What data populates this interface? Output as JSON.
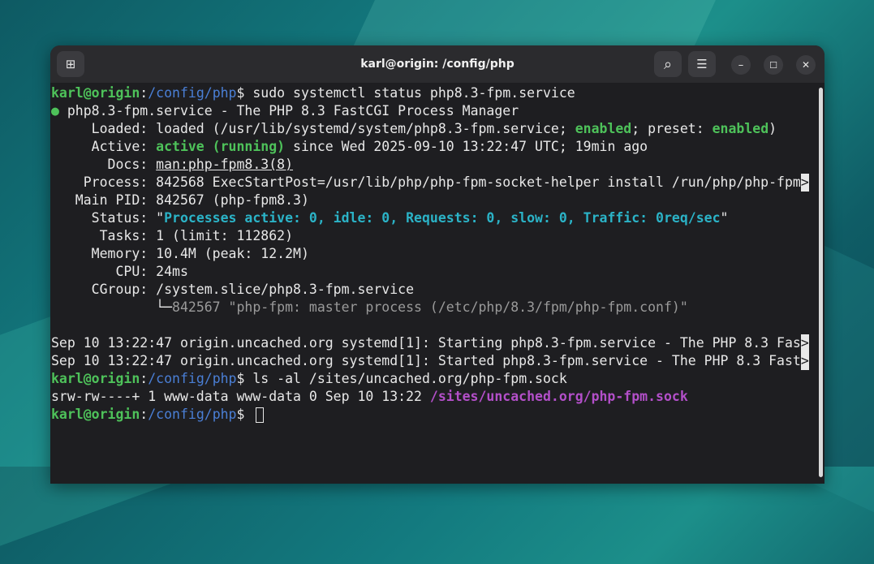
{
  "window": {
    "title": "karl@origin: /config/php"
  },
  "icons": {
    "new_tab": "⊞",
    "search": "⌕",
    "menu": "☰",
    "minimize": "–",
    "maximize": "☐",
    "close": "✕"
  },
  "terminal": {
    "prompt_user": "karl@origin",
    "prompt_sep": ":",
    "prompt_path": "/config/php",
    "prompt_end": "$ ",
    "cmd1": "sudo systemctl status php8.3-fpm.service",
    "status_dot": "●",
    "service_line": " php8.3-fpm.service - The PHP 8.3 FastCGI Process Manager",
    "loaded_pre": "     Loaded: loaded (/usr/lib/systemd/system/php8.3-fpm.service; ",
    "enabled1": "enabled",
    "loaded_mid": "; preset: ",
    "enabled2": "enabled",
    "loaded_post": ")",
    "active_pre": "     Active: ",
    "active_state": "active (running)",
    "active_post": " since Wed 2025-09-10 13:22:47 UTC; 19min ago",
    "docs_pre": "       Docs: ",
    "docs_link": "man:php-fpm8.3(8)",
    "process_line": "    Process: 842568 ExecStartPost=/usr/lib/php/php-fpm-socket-helper install /run/php/php-fpm",
    "mainpid_line": "   Main PID: 842567 (php-fpm8.3)",
    "status_pre": "     Status: \"",
    "status_val": "Processes active: 0, idle: 0, Requests: 0, slow: 0, Traffic: 0req/sec",
    "status_post": "\"",
    "tasks_line": "      Tasks: 1 (limit: 112862)",
    "memory_line": "     Memory: 10.4M (peak: 12.2M)",
    "cpu_line": "        CPU: 24ms",
    "cgroup_line": "     CGroup: /system.slice/php8.3-fpm.service",
    "tree_pre": "             └─",
    "tree_proc": "842567 \"php-fpm: master process (/etc/php/8.3/fpm/php-fpm.conf)\"",
    "log1": "Sep 10 13:22:47 origin.uncached.org systemd[1]: Starting php8.3-fpm.service - The PHP 8.3 Fas",
    "log2": "Sep 10 13:22:47 origin.uncached.org systemd[1]: Started php8.3-fpm.service - The PHP 8.3 Fast",
    "truncation_marker": ">",
    "cmd2": "ls -al /sites/uncached.org/php-fpm.sock",
    "ls_pre": "srw-rw----+ 1 www-data www-data 0 Sep 10 13:22 ",
    "ls_path": "/sites/uncached.org/php-fpm.sock"
  }
}
